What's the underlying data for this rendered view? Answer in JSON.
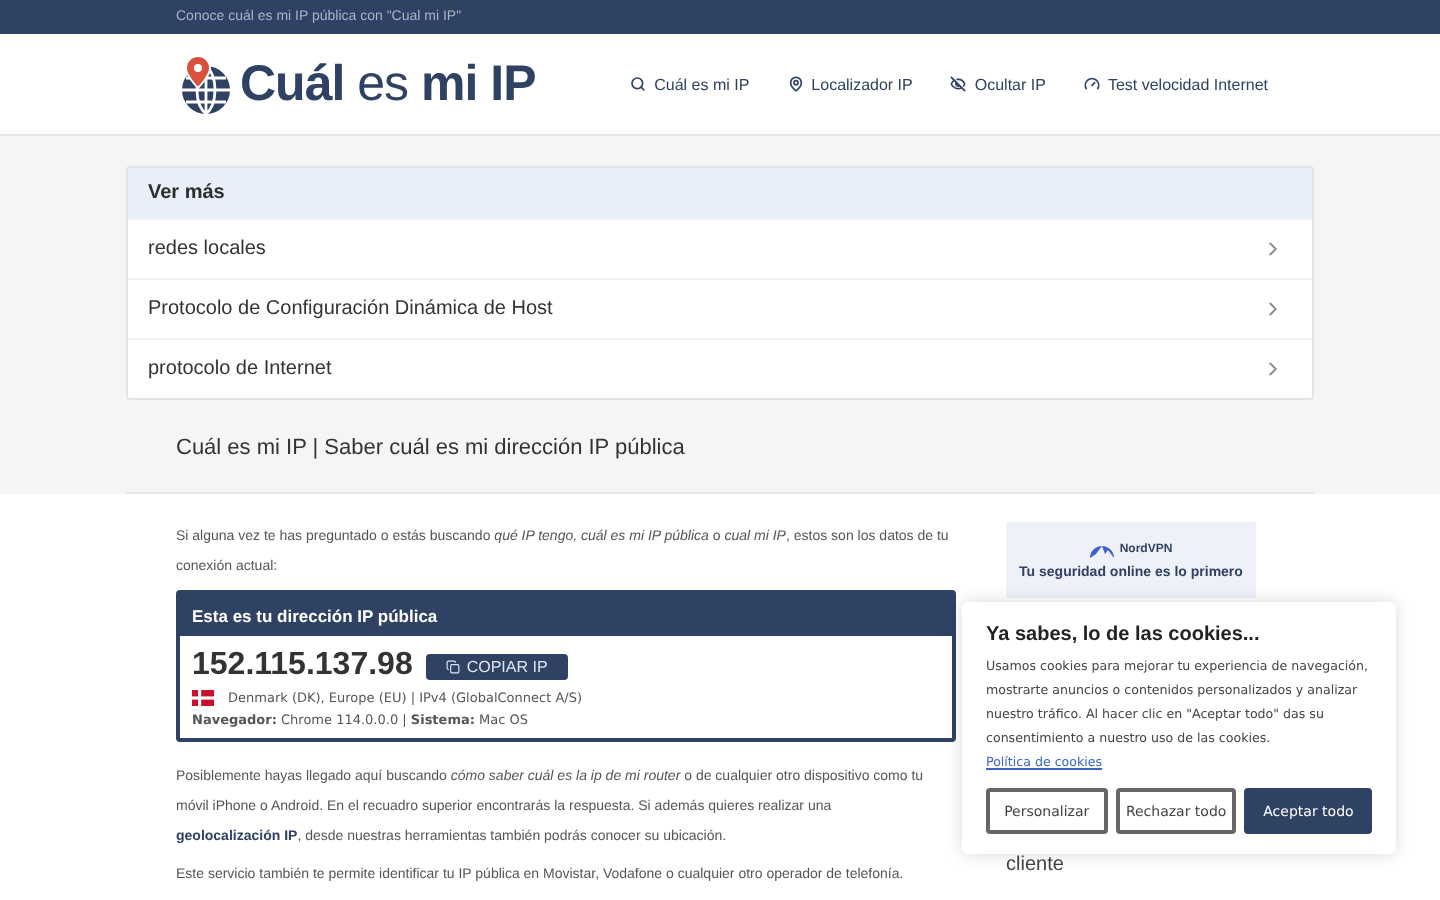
{
  "top_bar": {
    "text": "Conoce cuál es mi IP pública con \"Cual mi IP\""
  },
  "header": {
    "logo": {
      "light": "Cuál",
      "middle": "es",
      "bold": "mi IP"
    },
    "nav": [
      {
        "label": "Cuál es mi IP",
        "kind": "search"
      },
      {
        "label": "Localizador IP",
        "kind": "pin"
      },
      {
        "label": "Ocultar IP",
        "kind": "hide"
      },
      {
        "label": "Test velocidad Internet",
        "kind": "speed"
      }
    ]
  },
  "see_more": {
    "title": "Ver más",
    "items": [
      "redes locales",
      "Protocolo de Configuración Dinámica de Host",
      "protocolo de Internet"
    ]
  },
  "page_title": "Cuál es mi IP | Saber cuál es mi dirección IP pública",
  "intro": "Si alguna vez te has preguntado o estás buscando *qué IP tengo, cuál es mi IP pública* o *cual mi IP*, estos son los datos de tu conexión actual:",
  "ip_box": {
    "title": "Esta es tu dirección IP pública",
    "ip": "152.115.137.98",
    "copy_button": "COPIAR IP",
    "location": "Denmark (DK), Europe (EU) | IPv4 (GlobalConnect A/S)",
    "details": "**Navegador:** Chrome 114.0.0.0 | **Sistema:** Mac OS"
  },
  "paragraphs": [
    {
      "text": "Posiblemente hayas llegado aquí buscando *cómo saber cuál es la ip de mi router* o de cualquier otro dispositivo como tu móvil iPhone o Android. En el recuadro superior encontrarás la respuesta. Si además quieres realizar una ",
      "link": "geolocalización IP",
      "after": ", desde nuestras herramientas también podrás conocer su ubicación."
    },
    {
      "text": "Este servicio también te permite identificar tu IP pública en Movistar, Vodafone o cualquier otro operador de telefonía."
    }
  ],
  "ad": {
    "brand": "NordVPN",
    "tagline": "Tu seguridad online es lo primero"
  },
  "sidebar_text": "cliente",
  "cookie_banner": {
    "title": "Ya sabes, lo de las cookies...",
    "text": "Usamos cookies para mejorar tu experiencia de navegación, mostrarte anuncios o contenidos personalizados y analizar nuestro tráfico. Al hacer clic en \"Aceptar todo\" das su consentimiento a nuestro uso de las cookies.",
    "link": "Política de cookies",
    "buttons": [
      {
        "label": "Personalizar",
        "kind": "outline"
      },
      {
        "label": "Rechazar todo",
        "kind": "outline"
      },
      {
        "label": "Aceptar todo",
        "kind": "primary"
      }
    ]
  }
}
